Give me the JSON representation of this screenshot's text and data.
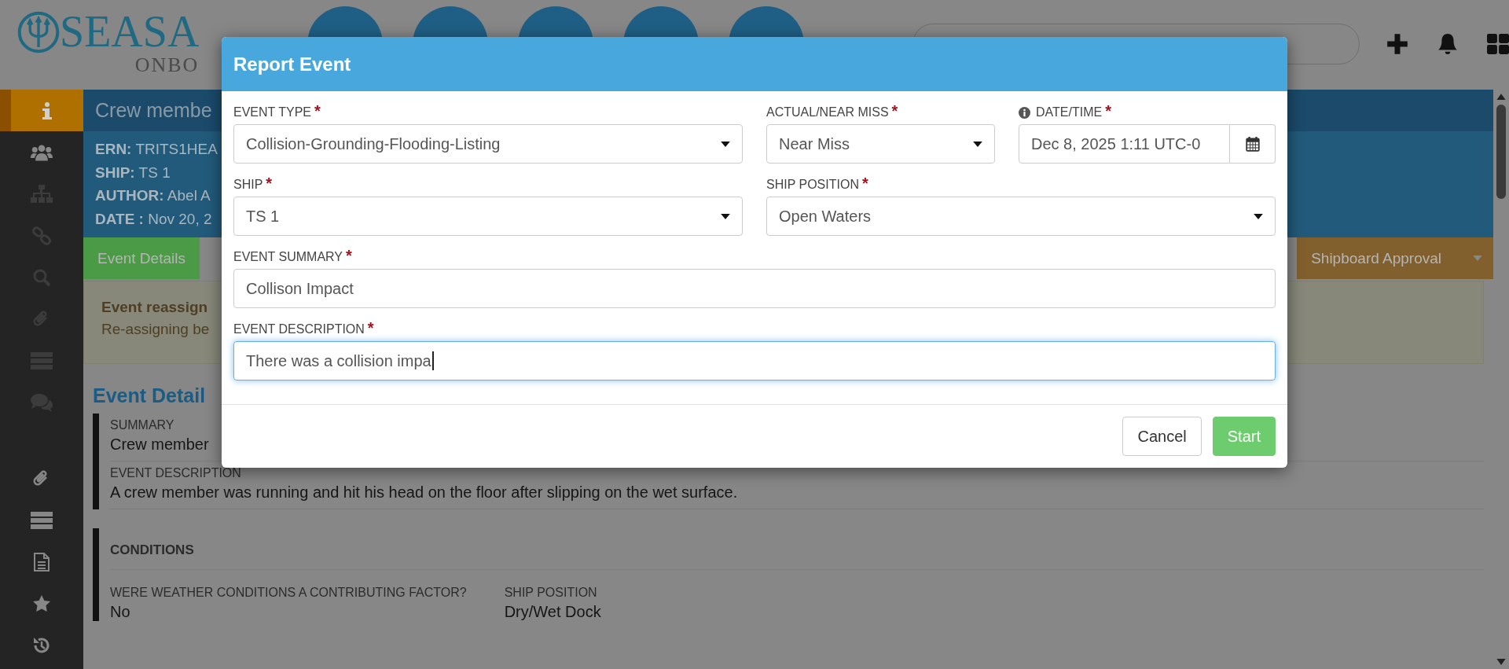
{
  "header": {
    "logo": {
      "name": "SEASA",
      "subtitle": "ONBO"
    }
  },
  "sidebar": {
    "items": [
      {
        "kind": "info",
        "selected": true,
        "disabled": false
      },
      {
        "kind": "users",
        "selected": false,
        "disabled": false
      },
      {
        "kind": "sitemap",
        "selected": false,
        "disabled": true
      },
      {
        "kind": "link",
        "selected": false,
        "disabled": true
      },
      {
        "kind": "search",
        "selected": false,
        "disabled": true
      },
      {
        "kind": "paperclip",
        "selected": false,
        "disabled": true
      },
      {
        "kind": "list",
        "selected": false,
        "disabled": true
      },
      {
        "kind": "comments",
        "selected": false,
        "disabled": true
      }
    ],
    "lower_items": [
      {
        "kind": "paperclip",
        "selected": false,
        "disabled": false
      },
      {
        "kind": "list",
        "selected": false,
        "disabled": false
      },
      {
        "kind": "file",
        "selected": false,
        "disabled": false
      },
      {
        "kind": "star",
        "selected": false,
        "disabled": false
      },
      {
        "kind": "history",
        "selected": false,
        "disabled": false
      }
    ]
  },
  "event": {
    "title": "Crew membe",
    "info": [
      {
        "label": "ERN:",
        "value": "TRITS1HEA"
      },
      {
        "label": "SHIP:",
        "value": "TS 1"
      },
      {
        "label": "AUTHOR:",
        "value": "Abel A"
      },
      {
        "label": "DATE :",
        "value": "Nov 20, 2"
      }
    ],
    "steps": [
      {
        "label": "Event Details",
        "color": "#4b9a46",
        "has_menu": false
      },
      {
        "label": "Shipboard Approval",
        "color": "#82602e",
        "has_menu": true
      }
    ],
    "alert": {
      "title": "Event reassign",
      "text": "Re-assigning be"
    },
    "section_title": "Event Detail",
    "details": [
      {
        "label": "SUMMARY",
        "value": "Crew member"
      },
      {
        "label": "EVENT DESCRIPTION",
        "value": "A crew member was running and hit his head on the floor after slipping on the wet surface."
      }
    ],
    "conditions": {
      "title": "CONDITIONS",
      "fields": [
        {
          "label": "WERE WEATHER CONDITIONS A CONTRIBUTING FACTOR?",
          "value": "No"
        },
        {
          "label": "SHIP POSITION",
          "value": "Dry/Wet Dock"
        }
      ]
    }
  },
  "modal": {
    "title": "Report Event",
    "fields": [
      {
        "kind": "select",
        "label": "EVENT TYPE",
        "required_mark": "*",
        "has_info": false,
        "value": "Collision-Grounding-Flooding-Listing",
        "focused": false
      },
      {
        "kind": "select",
        "label": "ACTUAL/NEAR MISS",
        "required_mark": "*",
        "has_info": false,
        "value": "Near Miss",
        "focused": false
      },
      {
        "kind": "datetime",
        "label": "DATE/TIME",
        "required_mark": "*",
        "has_info": true,
        "value": "Dec 8, 2025 1:11 UTC-0",
        "focused": false
      },
      {
        "kind": "select",
        "label": "SHIP",
        "required_mark": "*",
        "has_info": false,
        "value": "TS 1",
        "focused": false
      },
      {
        "kind": "select",
        "label": "SHIP POSITION",
        "required_mark": "*",
        "has_info": false,
        "value": "Open Waters",
        "focused": false
      },
      {
        "kind": "text",
        "label": "EVENT SUMMARY",
        "required_mark": "*",
        "has_info": false,
        "value": "Collison Impact",
        "focused": false
      },
      {
        "kind": "text",
        "label": "EVENT DESCRIPTION",
        "required_mark": "*",
        "has_info": false,
        "value": "There was a collision impa",
        "focused": true
      }
    ],
    "buttons": [
      {
        "kind": "default",
        "label": "Cancel"
      },
      {
        "kind": "primary",
        "label": "Start"
      }
    ]
  }
}
